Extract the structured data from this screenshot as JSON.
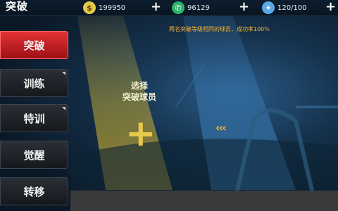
{
  "header": {
    "title": "突破",
    "resources": [
      {
        "icon": "coin-icon",
        "value": "199950",
        "color": "#e8c84a"
      },
      {
        "icon": "stamina-icon",
        "value": "96129",
        "color": "#2fb36b"
      },
      {
        "icon": "energy-icon",
        "value": "120/100",
        "color": "#5aa8e8"
      }
    ],
    "plus_label": "+"
  },
  "sidebar": {
    "items": [
      {
        "label": "突破",
        "active": true
      },
      {
        "label": "训练",
        "active": false
      },
      {
        "label": "特训",
        "active": false
      },
      {
        "label": "觉醒",
        "active": false
      },
      {
        "label": "转移",
        "active": false
      }
    ]
  },
  "main": {
    "notice": "两名突破等级相同的球员，成功率100%",
    "select_label": "选择\n突破球员",
    "add_symbol": "+",
    "arrows": "‹‹‹"
  },
  "colors": {
    "accent": "#e23236",
    "notice": "#ffb32e",
    "gold": "#e8c84a"
  }
}
